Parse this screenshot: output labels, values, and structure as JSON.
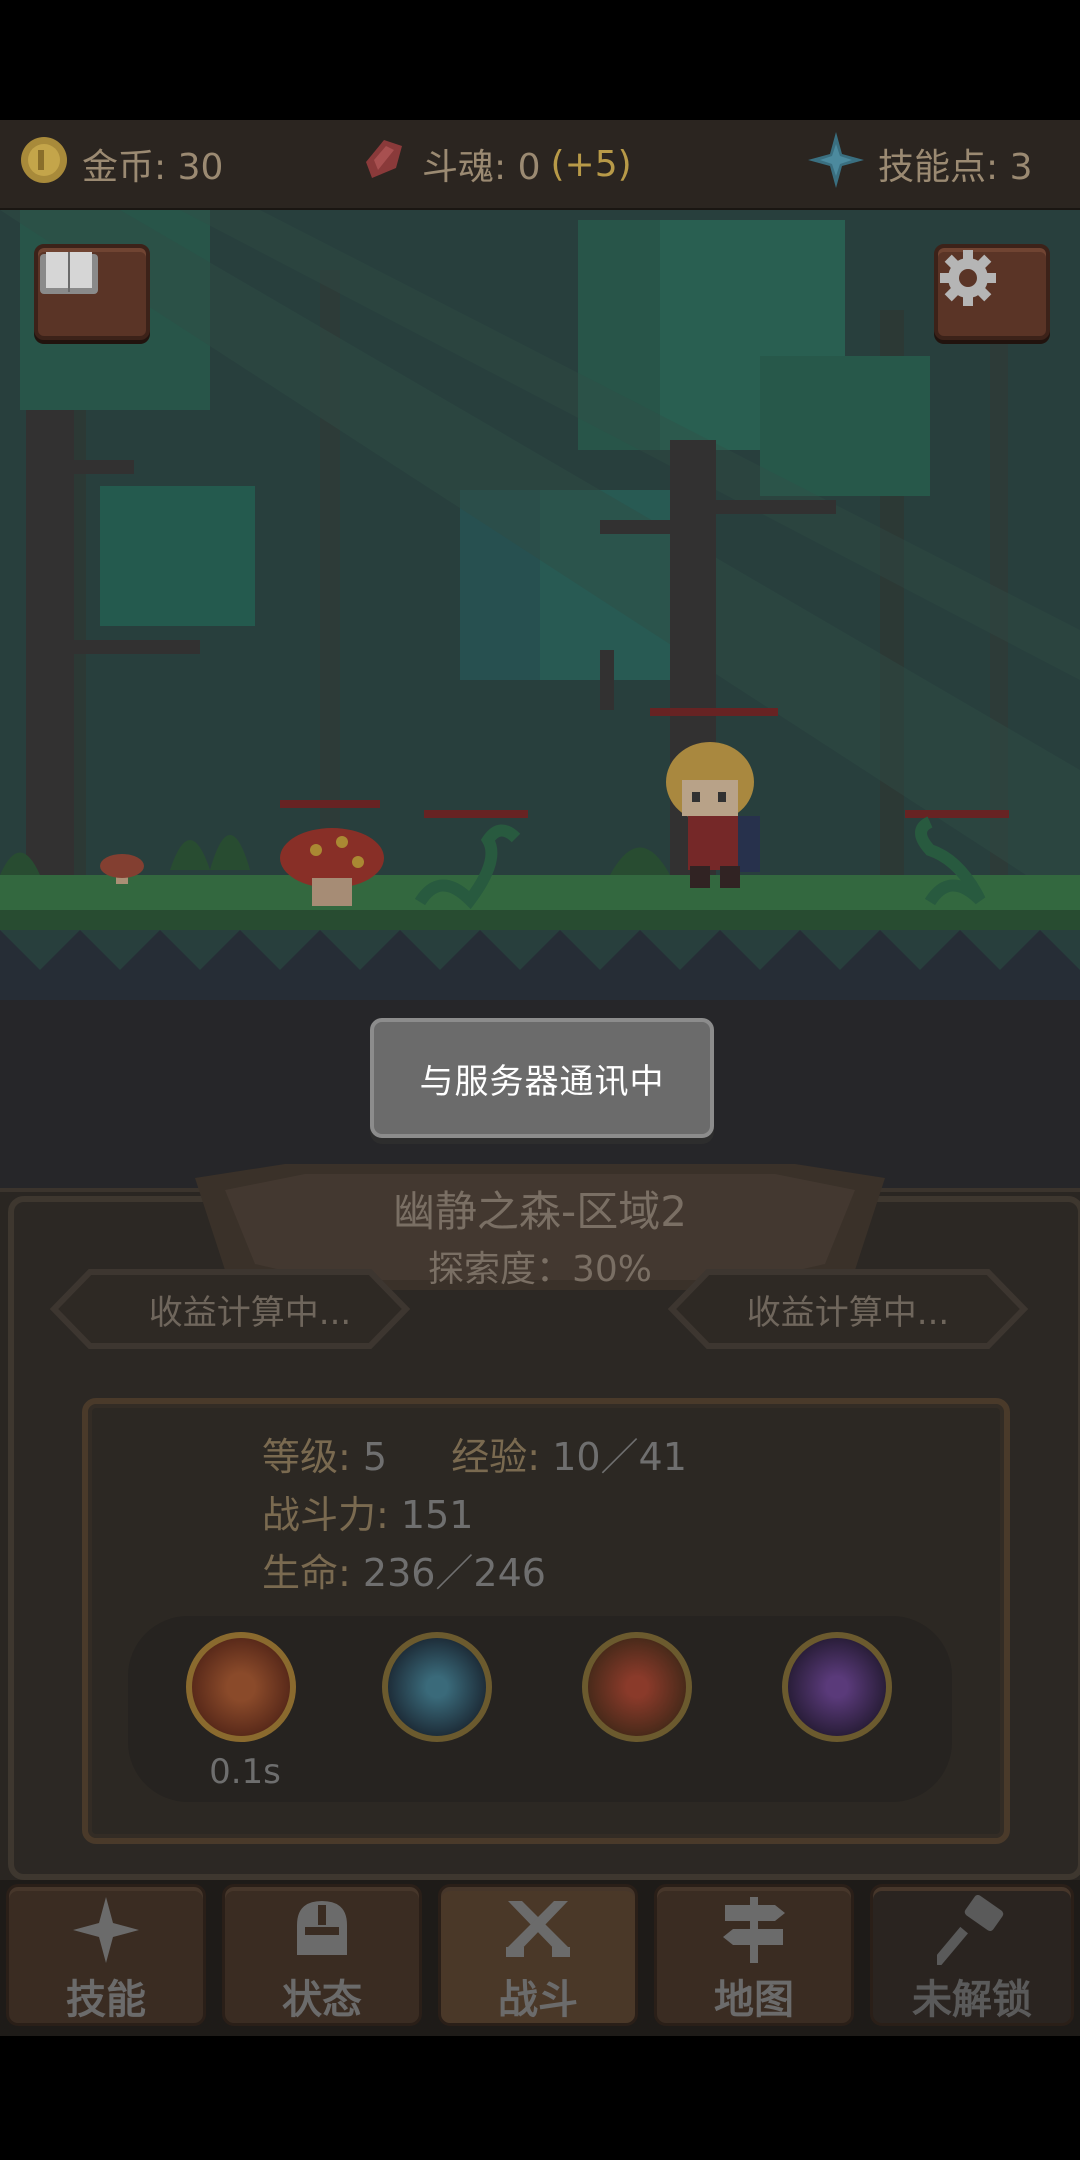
{
  "resources": {
    "gold_label": "金币: 30",
    "soul_label": "斗魂: 0",
    "soul_bonus": "(+5)",
    "skill_points_label": "技能点: 3"
  },
  "scene": {
    "book_icon": "book-icon",
    "settings_icon": "gear-icon"
  },
  "toast": "与服务器通讯中",
  "area": {
    "name": "幽静之森-区域2",
    "explore": "探索度：30%"
  },
  "earnings": {
    "left": "收益计算中...",
    "right": "收益计算中..."
  },
  "stats": {
    "level_label": "等级:",
    "level_value": "5",
    "exp_label": "经验:",
    "exp_value": "10／41",
    "power_label": "战斗力:",
    "power_value": "151",
    "hp_label": "生命:",
    "hp_value": "236／246"
  },
  "skills": {
    "cooldown": "0.1s"
  },
  "nav": [
    {
      "label": "技能",
      "icon": "sparkle-icon"
    },
    {
      "label": "状态",
      "icon": "helmet-icon"
    },
    {
      "label": "战斗",
      "icon": "crossed-swords-icon"
    },
    {
      "label": "地图",
      "icon": "signpost-icon"
    },
    {
      "label": "未解锁",
      "icon": "hammer-icon"
    }
  ],
  "colors": {
    "accent_gold": "#b89a48",
    "panel_bg": "#2c2824",
    "toast_bg": "#6b6b6b"
  }
}
